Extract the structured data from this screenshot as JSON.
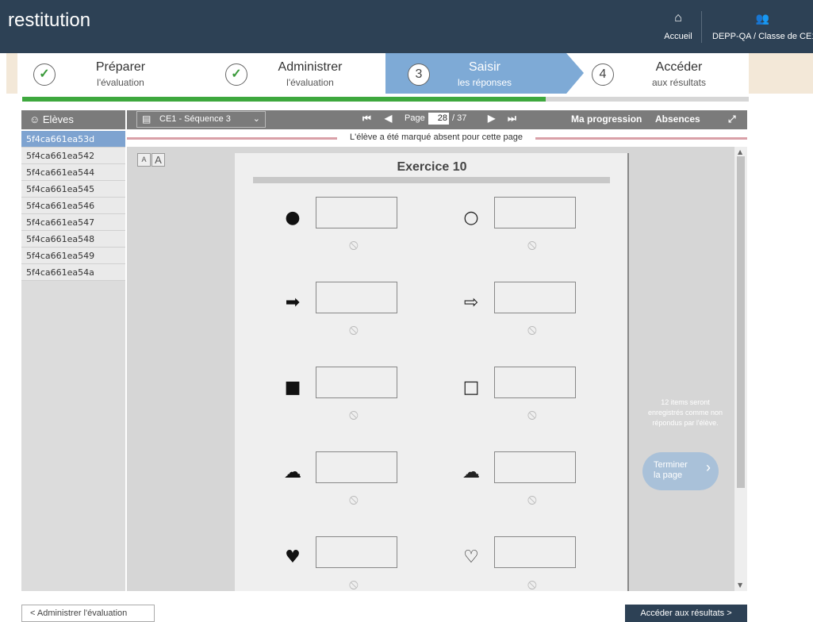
{
  "app": {
    "title": "restitution"
  },
  "header": {
    "home": {
      "icon": "home-icon",
      "label": "Accueil"
    },
    "user": {
      "icon": "users-icon",
      "label": "DEPP-QA / Classe de CE1"
    }
  },
  "steps": [
    {
      "number": "✓",
      "title": "Préparer",
      "subtitle": "l'évaluation",
      "state": "done"
    },
    {
      "number": "✓",
      "title": "Administrer",
      "subtitle": "l'évaluation",
      "state": "done"
    },
    {
      "number": "3",
      "title": "Saisir",
      "subtitle": "les réponses",
      "state": "active"
    },
    {
      "number": "4",
      "title": "Accéder",
      "subtitle": "aux résultats",
      "state": "todo"
    }
  ],
  "progress": {
    "fraction": 0.72
  },
  "sidebar": {
    "title": "Elèves",
    "students": [
      "5f4ca661ea53d",
      "5f4ca661ea542",
      "5f4ca661ea544",
      "5f4ca661ea545",
      "5f4ca661ea546",
      "5f4ca661ea547",
      "5f4ca661ea548",
      "5f4ca661ea549",
      "5f4ca661ea54a"
    ],
    "selected": 0
  },
  "toolbar": {
    "sequence": "CE1 - Séquence 3",
    "page_label": "Page",
    "page_current": "28",
    "page_total": "/ 37",
    "progress_link": "Ma progression",
    "absences_link": "Absences"
  },
  "absent_notice": "L'élève a été marqué absent pour cette page",
  "font_buttons": [
    "A",
    "A"
  ],
  "exercise": {
    "title": "Exercice 10",
    "shapes": [
      {
        "left": "●",
        "right": "○"
      },
      {
        "left": "➡",
        "right": "⇨"
      },
      {
        "left": "■",
        "right": "□"
      },
      {
        "left": "☁",
        "right": "☁"
      },
      {
        "left": "♥",
        "right": "♡"
      }
    ],
    "na_glyph": "⦸"
  },
  "right_panel": {
    "note": "12 items seront enregistrés comme non répondus par l'élève.",
    "finish_label_1": "Terminer",
    "finish_label_2": "la page"
  },
  "footer": {
    "back": "<  Administrer l'évaluation",
    "next": "Accéder aux résultats  >"
  }
}
